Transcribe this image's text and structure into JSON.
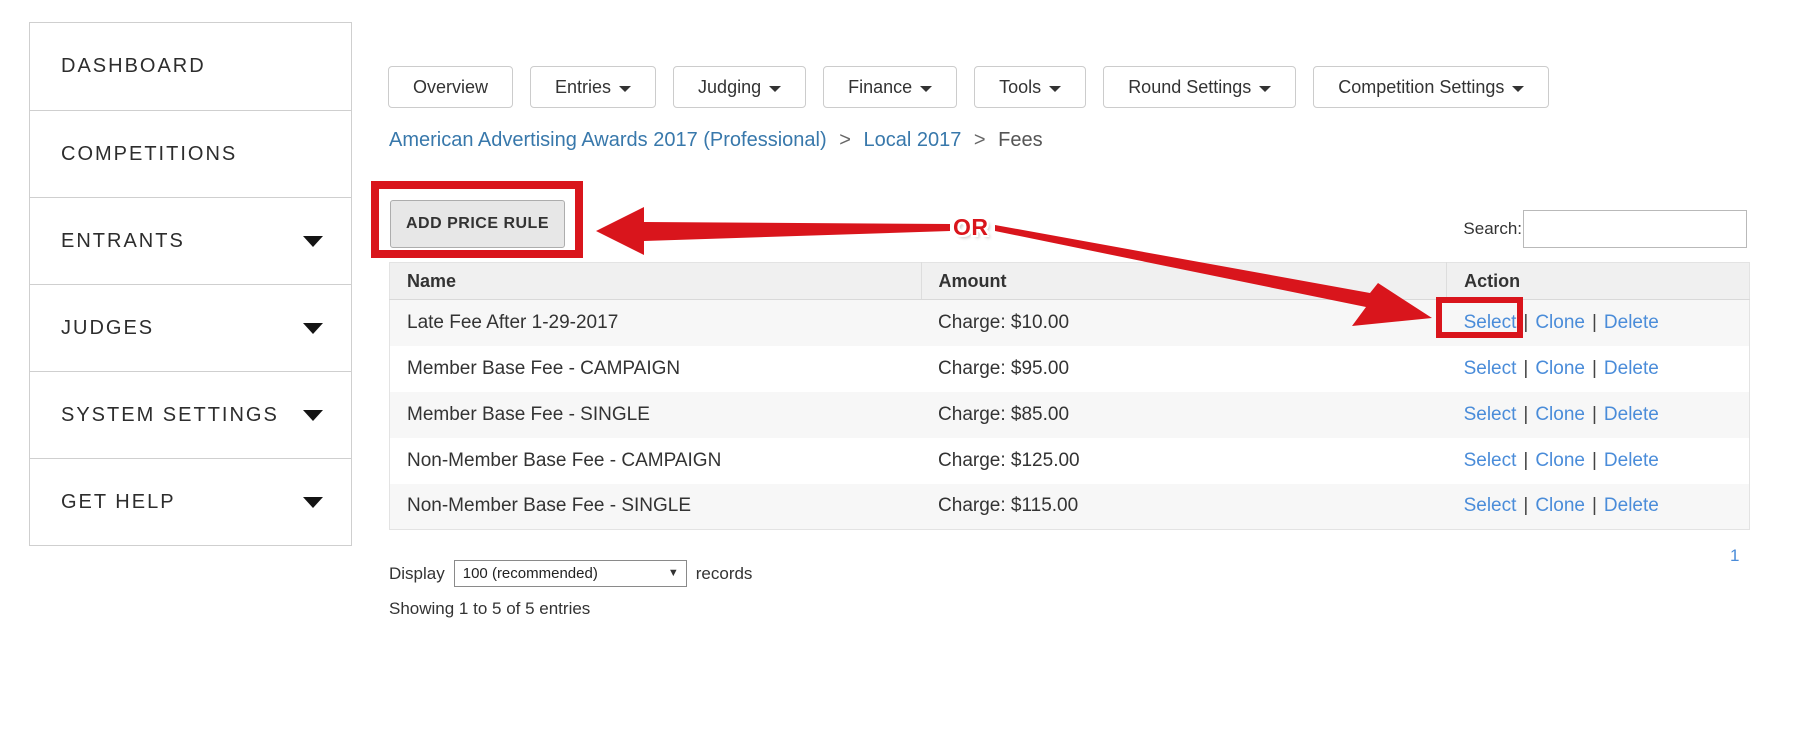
{
  "sidebar": {
    "items": [
      {
        "label": "DASHBOARD"
      },
      {
        "label": "COMPETITIONS"
      },
      {
        "label": "ENTRANTS"
      },
      {
        "label": "JUDGES"
      },
      {
        "label": "SYSTEM SETTINGS"
      },
      {
        "label": "GET HELP"
      }
    ]
  },
  "nav": {
    "buttons": [
      {
        "label": "Overview"
      },
      {
        "label": "Entries"
      },
      {
        "label": "Judging"
      },
      {
        "label": "Finance"
      },
      {
        "label": "Tools"
      },
      {
        "label": "Round Settings"
      },
      {
        "label": "Competition Settings"
      }
    ]
  },
  "breadcrumb": {
    "links": [
      "American Advertising Awards 2017 (Professional)",
      "Local 2017"
    ],
    "current": "Fees",
    "separator": ">"
  },
  "toolbar": {
    "add_price_rule_label": "ADD PRICE RULE",
    "search_label": "Search:",
    "search_value": ""
  },
  "annotation": {
    "or_label": "OR",
    "highlight_color": "#d9151c"
  },
  "table": {
    "columns": [
      "Name",
      "Amount",
      "Action"
    ],
    "action_separator": "|",
    "rows": [
      {
        "name": "Late Fee After 1-29-2017",
        "amount": "Charge: $10.00",
        "select": "Select",
        "clone": "Clone",
        "delete": "Delete"
      },
      {
        "name": "Member Base Fee - CAMPAIGN",
        "amount": "Charge: $95.00",
        "select": "Select",
        "clone": "Clone",
        "delete": "Delete"
      },
      {
        "name": "Member Base Fee - SINGLE",
        "amount": "Charge: $85.00",
        "select": "Select",
        "clone": "Clone",
        "delete": "Delete"
      },
      {
        "name": "Non-Member Base Fee - CAMPAIGN",
        "amount": "Charge: $125.00",
        "select": "Select",
        "clone": "Clone",
        "delete": "Delete"
      },
      {
        "name": "Non-Member Base Fee - SINGLE",
        "amount": "Charge: $115.00",
        "select": "Select",
        "clone": "Clone",
        "delete": "Delete"
      }
    ]
  },
  "footer": {
    "display_label": "Display",
    "display_value": "100 (recommended)",
    "records_label": "records",
    "showing_text": "Showing 1 to 5 of 5 entries",
    "page": "1"
  },
  "colors": {
    "accent_red": "#d9151c",
    "link_blue": "#4a8cd9",
    "breadcrumb_blue": "#3878ab"
  }
}
